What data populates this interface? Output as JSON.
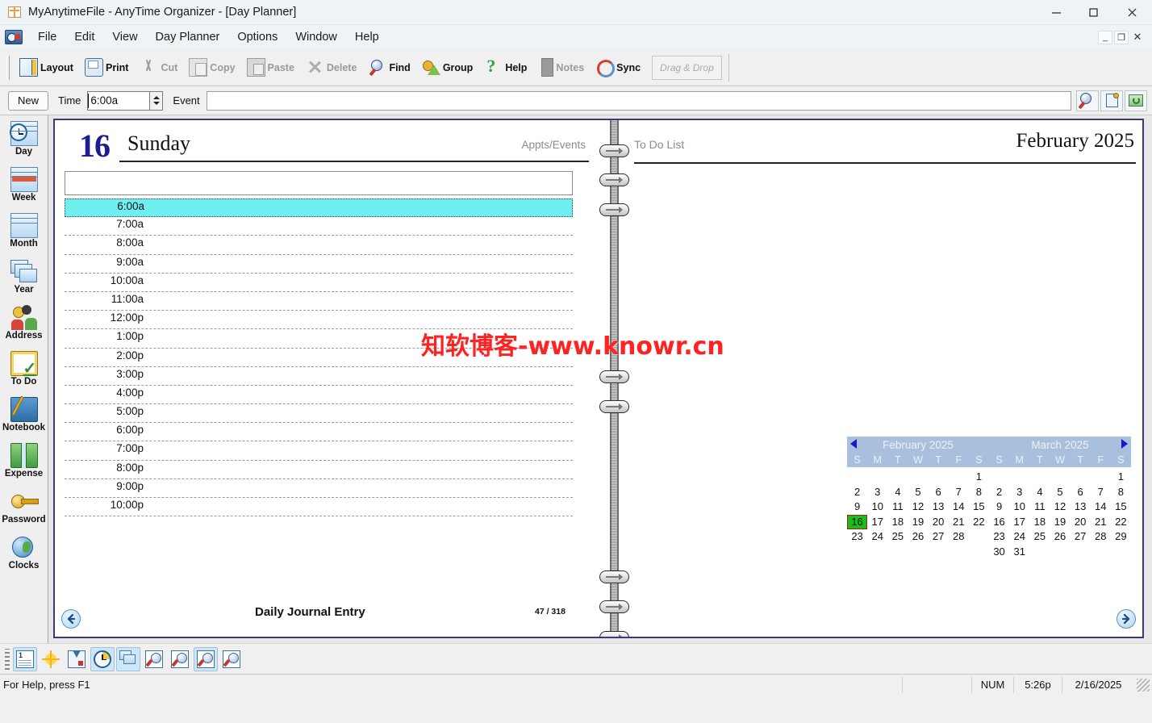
{
  "window": {
    "title": "MyAnytimeFile - AnyTime Organizer - [Day Planner]",
    "app_icon": "calendar-icon",
    "minimize": "—",
    "maximize": "□",
    "close": "✕",
    "mdi_minimize": "_",
    "mdi_restore": "❐",
    "mdi_close": "✕"
  },
  "menu": {
    "icon": "organizer-icon",
    "items": [
      "File",
      "Edit",
      "View",
      "Day Planner",
      "Options",
      "Window",
      "Help"
    ]
  },
  "toolbar": {
    "buttons": [
      {
        "label": "Layout",
        "icon": "layout-icon",
        "enabled": true
      },
      {
        "label": "Print",
        "icon": "print-icon",
        "enabled": true
      },
      {
        "label": "Cut",
        "icon": "cut-icon",
        "enabled": false
      },
      {
        "label": "Copy",
        "icon": "copy-icon",
        "enabled": false
      },
      {
        "label": "Paste",
        "icon": "paste-icon",
        "enabled": false
      },
      {
        "label": "Delete",
        "icon": "delete-icon",
        "enabled": false
      },
      {
        "label": "Find",
        "icon": "find-icon",
        "enabled": true
      },
      {
        "label": "Group",
        "icon": "group-icon",
        "enabled": true
      },
      {
        "label": "Help",
        "icon": "help-icon",
        "enabled": true
      },
      {
        "label": "Notes",
        "icon": "notes-icon",
        "enabled": false
      },
      {
        "label": "Sync",
        "icon": "sync-icon",
        "enabled": true
      }
    ],
    "drag_drop_label": "Drag & Drop"
  },
  "entry_row": {
    "new_label": "New",
    "time_label": "Time",
    "time_value": "6:00a",
    "event_label": "Event",
    "event_value": "",
    "event_placeholder": "",
    "right_buttons": [
      "find-record-icon",
      "pin-record-icon",
      "refresh-icon"
    ]
  },
  "sidebar": {
    "items": [
      {
        "label": "Day",
        "icon": "day-clock-calendar-icon"
      },
      {
        "label": "Week",
        "icon": "week-calendar-icon"
      },
      {
        "label": "Month",
        "icon": "month-calendar-icon"
      },
      {
        "label": "Year",
        "icon": "year-stack-icon"
      },
      {
        "label": "Address",
        "icon": "address-people-icon"
      },
      {
        "label": "To Do",
        "icon": "todo-checklist-icon"
      },
      {
        "label": "Notebook",
        "icon": "notebook-pen-icon"
      },
      {
        "label": "Expense",
        "icon": "expense-money-icon"
      },
      {
        "label": "Password",
        "icon": "password-key-icon"
      },
      {
        "label": "Clocks",
        "icon": "clocks-globe-icon"
      }
    ]
  },
  "planner": {
    "day_number": "16",
    "day_name": "Sunday",
    "appts_label": "Appts/Events",
    "all_day_value": "",
    "time_slots": [
      {
        "time": "6:00a",
        "selected": true,
        "event": ""
      },
      {
        "time": "7:00a",
        "selected": false,
        "event": ""
      },
      {
        "time": "8:00a",
        "selected": false,
        "event": ""
      },
      {
        "time": "9:00a",
        "selected": false,
        "event": ""
      },
      {
        "time": "10:00a",
        "selected": false,
        "event": ""
      },
      {
        "time": "11:00a",
        "selected": false,
        "event": ""
      },
      {
        "time": "12:00p",
        "selected": false,
        "event": ""
      },
      {
        "time": "1:00p",
        "selected": false,
        "event": ""
      },
      {
        "time": "2:00p",
        "selected": false,
        "event": ""
      },
      {
        "time": "3:00p",
        "selected": false,
        "event": ""
      },
      {
        "time": "4:00p",
        "selected": false,
        "event": ""
      },
      {
        "time": "5:00p",
        "selected": false,
        "event": ""
      },
      {
        "time": "6:00p",
        "selected": false,
        "event": ""
      },
      {
        "time": "7:00p",
        "selected": false,
        "event": ""
      },
      {
        "time": "8:00p",
        "selected": false,
        "event": ""
      },
      {
        "time": "9:00p",
        "selected": false,
        "event": ""
      },
      {
        "time": "10:00p",
        "selected": false,
        "event": ""
      }
    ],
    "journal_label": "Daily Journal Entry",
    "page_counter": "47 / 318",
    "prev_icon": "arrow-left-icon",
    "next_icon": "arrow-right-icon",
    "watermark": "知软博客-www.knowr.cn"
  },
  "todo_panel": {
    "title": "To Do List",
    "month_title": "February 2025",
    "items": []
  },
  "mini_calendars": {
    "prev_arrow": "arrow-left-icon",
    "next_arrow": "arrow-right-icon",
    "dow": [
      "S",
      "M",
      "T",
      "W",
      "T",
      "F",
      "S"
    ],
    "months": [
      {
        "title": "February 2025",
        "lead_blanks": 6,
        "days": 28,
        "today": 16
      },
      {
        "title": "March 2025",
        "lead_blanks": 6,
        "days": 31,
        "today": null
      }
    ]
  },
  "bottom_toolbar": {
    "buttons": [
      {
        "icon": "journal-note-icon",
        "active": true
      },
      {
        "icon": "sun-holiday-icon",
        "active": false
      },
      {
        "icon": "import-icon",
        "active": false
      },
      {
        "icon": "time-clock-icon",
        "active": true
      },
      {
        "icon": "grid-layers-icon",
        "active": true
      },
      {
        "icon": "zoom-page-1-icon",
        "active": false
      },
      {
        "icon": "zoom-page-2-icon",
        "active": false
      },
      {
        "icon": "zoom-page-3-icon",
        "active": true
      },
      {
        "icon": "zoom-page-4-icon",
        "active": false
      }
    ]
  },
  "statusbar": {
    "help_text": "For Help, press F1",
    "num_lock": "NUM",
    "time": "5:26p",
    "date": "2/16/2025"
  },
  "colors": {
    "selection": "#6fefef",
    "today": "#17c017",
    "day_number": "#1d1d8e",
    "calendar_header": "#a8c0de",
    "watermark": "#ff2222",
    "page_border": "#3a3a7a"
  }
}
